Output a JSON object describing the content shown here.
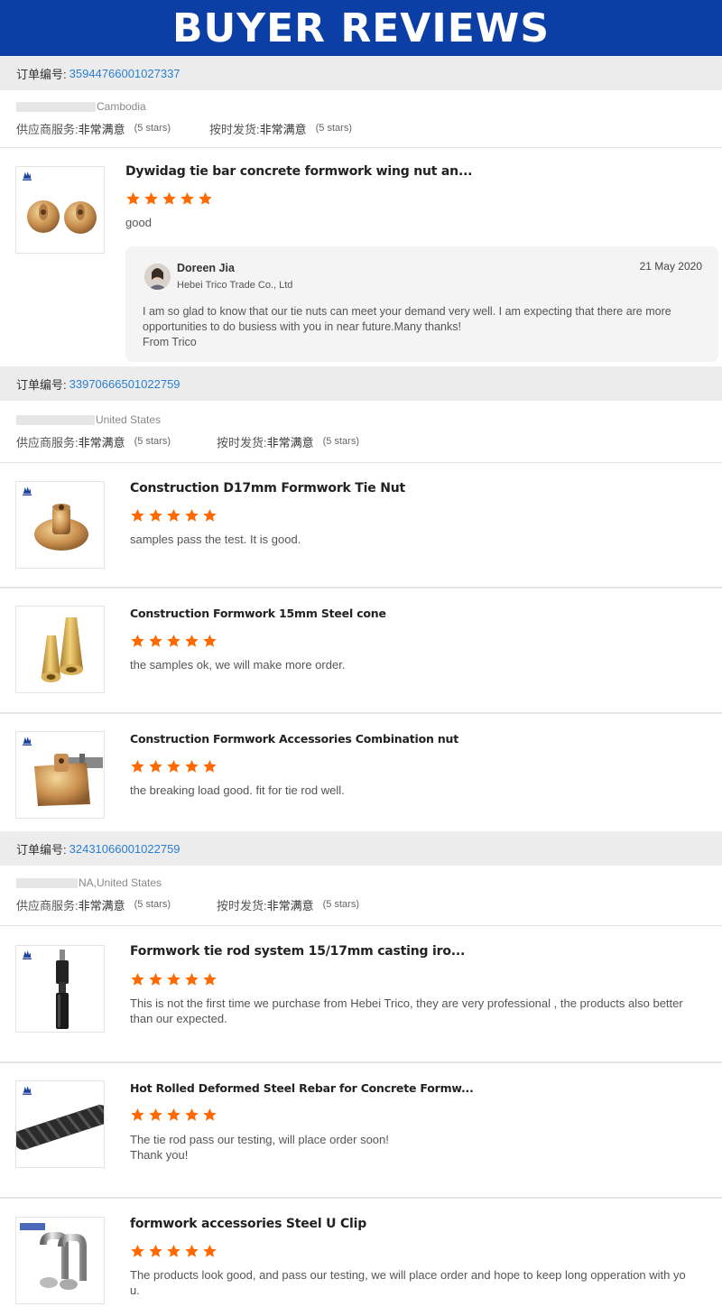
{
  "banner": {
    "title": "BUYER REVIEWS"
  },
  "order_label": "订单编号:",
  "ratings_labels": {
    "supplier_service": "供应商服务:",
    "on_time": "按时发货:",
    "value": "非常满意",
    "stars": "(5 stars)"
  },
  "colors": {
    "banner": "#0b3fa6",
    "star": "#ff6a00",
    "link": "#2a7fd1"
  },
  "orders": [
    {
      "number": "35944766001027337",
      "buyer_location": "Cambodia",
      "items": [
        {
          "title": "Dywidag tie bar concrete formwork wing nut an...",
          "rating": 5,
          "comment": "good",
          "image": "wing-nut-pair"
        }
      ],
      "reply": {
        "name": "Doreen Jia",
        "company": "Hebei Trico Trade Co., Ltd",
        "date": "21 May 2020",
        "line1": "I am so glad to know that our tie nuts can meet your demand very well. I am expecting that there are more",
        "line2": "opportunities to do busiess with you in near future.Many thanks!",
        "line3": "From Trico"
      }
    },
    {
      "number": "33970666501022759",
      "buyer_location": "United States",
      "items": [
        {
          "title": "Construction D17mm Formwork Tie Nut",
          "rating": 5,
          "comment": "samples pass the test. It is good.",
          "image": "tie-nut"
        },
        {
          "title": "Construction Formwork 15mm Steel cone",
          "rating": 5,
          "comment": "the samples ok, we will make more order.",
          "image": "steel-cone"
        },
        {
          "title": "Construction Formwork Accessories Combination nut",
          "rating": 5,
          "comment": "the breaking load good. fit for tie rod well.",
          "image": "combination-nut"
        }
      ]
    },
    {
      "number": "32431066001022759",
      "buyer_location": "NA,United States",
      "items": [
        {
          "title": "Formwork tie rod system 15/17mm casting iro...",
          "rating": 5,
          "comment_line1": "This is not the first time we purchase from Hebei Trico, they are very professional , the products also better",
          "comment_line2": "than our expected.",
          "image": "tie-rod"
        },
        {
          "title": "Hot Rolled Deformed Steel Rebar for Concrete Formw...",
          "rating": 5,
          "comment_line1": "The tie rod pass our testing, will place order soon!",
          "comment_line2": "Thank you!",
          "image": "rebar"
        },
        {
          "title": "formwork accessories Steel U Clip",
          "rating": 5,
          "comment_line1": "The products look good, and pass our testing, we will place order and hope to keep long opperation with yo",
          "comment_line2": "u.",
          "image": "u-clip"
        }
      ]
    }
  ]
}
